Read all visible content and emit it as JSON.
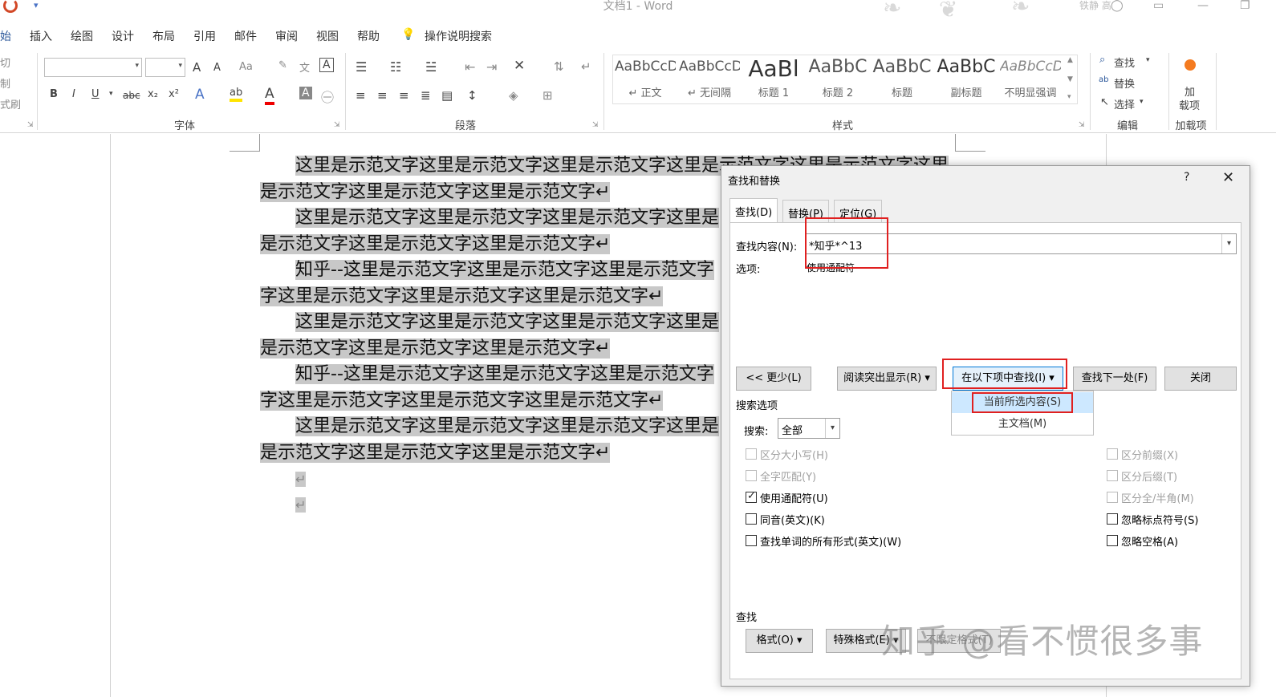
{
  "window": {
    "title": "文档1  -  Word",
    "user": "铁静 高"
  },
  "tabs": [
    "始",
    "插入",
    "绘图",
    "设计",
    "布局",
    "引用",
    "邮件",
    "审阅",
    "视图",
    "帮助",
    "操作说明搜索"
  ],
  "ribbon": {
    "clipboard": {
      "items": [
        "切",
        "制",
        "式刷"
      ]
    },
    "font": {
      "label": "字体",
      "grow": "A",
      "shrink": "A",
      "aa": "Aa",
      "bold": "B",
      "italic": "I",
      "underline": "U",
      "strike": "abc",
      "sub": "x₂",
      "sup": "x²"
    },
    "paragraph": {
      "label": "段落"
    },
    "styles": {
      "label": "样式",
      "items": [
        {
          "sample": "AaBbCcDc",
          "name": "↵ 正文"
        },
        {
          "sample": "AaBbCcDc",
          "name": "↵ 无间隔"
        },
        {
          "sample": "AaBl",
          "name": "标题 1"
        },
        {
          "sample": "AaBbC",
          "name": "标题 2"
        },
        {
          "sample": "AaBbC",
          "name": "标题"
        },
        {
          "sample": "AaBbC",
          "name": "副标题"
        },
        {
          "sample": "AaBbCcDc",
          "name": "不明显强调"
        }
      ]
    },
    "editing": {
      "label": "编辑",
      "find": "查找",
      "replace": "替换",
      "select": "选择"
    },
    "addins": {
      "label": "加载项",
      "button": "加\n载项",
      "btn_line1": "加",
      "btn_line2": "载项"
    }
  },
  "document": {
    "lines": [
      "这里是示范文字这里是示范文字这里是示范文字这里是示范文字这里是示范文字这里",
      "是示范文字这里是示范文字这里是示范文字↵",
      "这里是示范文字这里是示范文字这里是示范文字这里是",
      "是示范文字这里是示范文字这里是示范文字↵",
      "知乎--这里是示范文字这里是示范文字这里是示范文字",
      "字这里是示范文字这里是示范文字这里是示范文字↵",
      "这里是示范文字这里是示范文字这里是示范文字这里是",
      "是示范文字这里是示范文字这里是示范文字↵",
      "知乎--这里是示范文字这里是示范文字这里是示范文字",
      "字这里是示范文字这里是示范文字这里是示范文字↵",
      "这里是示范文字这里是示范文字这里是示范文字这里是",
      "是示范文字这里是示范文字这里是示范文字↵"
    ],
    "empty_marks": [
      "↵",
      "↵"
    ]
  },
  "dialog": {
    "title": "查找和替换",
    "help": "?",
    "close": "✕",
    "tabs": [
      "查找(D)",
      "替换(P)",
      "定位(G)"
    ],
    "find_label": "查找内容(N):",
    "find_value": "*知乎*^13",
    "options_label": "选项:",
    "options_value": "使用通配符",
    "buttons": {
      "less": "<< 更少(L)",
      "reading_highlight": "阅读突出显示(R) ▾",
      "find_in": "在以下项中查找(I) ▾",
      "find_next": "查找下一处(F)",
      "close": "关闭"
    },
    "find_in_menu": [
      "当前所选内容(S)",
      "主文档(M)"
    ],
    "search_options_label": "搜索选项",
    "search_label": "搜索:",
    "search_value": "全部",
    "options_left": [
      {
        "label": "区分大小写(H)",
        "checked": false,
        "enabled": false
      },
      {
        "label": "全字匹配(Y)",
        "checked": false,
        "enabled": false
      },
      {
        "label": "使用通配符(U)",
        "checked": true,
        "enabled": true
      },
      {
        "label": "同音(英文)(K)",
        "checked": false,
        "enabled": true
      },
      {
        "label": "查找单词的所有形式(英文)(W)",
        "checked": false,
        "enabled": true
      }
    ],
    "options_right": [
      {
        "label": "区分前缀(X)",
        "checked": false,
        "enabled": false
      },
      {
        "label": "区分后缀(T)",
        "checked": false,
        "enabled": false
      },
      {
        "label": "区分全/半角(M)",
        "checked": false,
        "enabled": false
      },
      {
        "label": "忽略标点符号(S)",
        "checked": false,
        "enabled": true
      },
      {
        "label": "忽略空格(A)",
        "checked": false,
        "enabled": true
      }
    ],
    "find_section_label": "查找",
    "format_button": "格式(O) ▾",
    "special_button": "特殊格式(E) ▾",
    "no_format_button": "不限定格式(T)"
  },
  "watermark": "知乎 @看不惯很多事",
  "colors": {
    "accent": "#2b579a",
    "highlight": "#c8c8c8",
    "redbox": "#e02020"
  }
}
